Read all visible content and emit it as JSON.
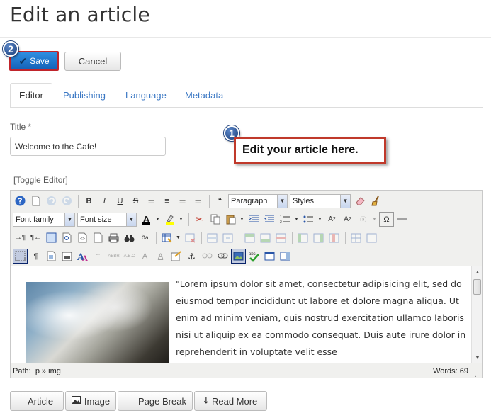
{
  "page": {
    "title": "Edit an article"
  },
  "toolbar": {
    "save_label": "Save",
    "cancel_label": "Cancel"
  },
  "badges": {
    "save_step": "2",
    "editor_step": "1"
  },
  "tabs": [
    {
      "label": "Editor",
      "active": true
    },
    {
      "label": "Publishing"
    },
    {
      "label": "Language"
    },
    {
      "label": "Metadata"
    }
  ],
  "form": {
    "title_label": "Title *",
    "title_value": "Welcome to the Cafe!"
  },
  "callout": {
    "text": "Edit your article here."
  },
  "toggle_editor": "[Toggle Editor]",
  "editor": {
    "format_select": "Paragraph",
    "styles_select": "Styles",
    "font_family_select": "Font family",
    "font_size_select": "Font size",
    "content_text": "\"Lorem ipsum dolor sit amet, consectetur adipisicing elit, sed do eiusmod tempor incididunt ut labore et dolore magna aliqua. Ut enim ad minim veniam, quis nostrud exercitation ullamco laboris nisi ut aliquip ex ea commodo consequat. Duis aute irure dolor in reprehenderit in voluptate velit esse",
    "path_label": "Path:",
    "path_value": "p » img",
    "word_count": "Words: 69"
  },
  "bottom_buttons": {
    "article": "Article",
    "image": "Image",
    "page_break": "Page Break",
    "read_more": "Read More"
  },
  "colors": {
    "accent": "#3b78c4",
    "save_bg": "#1f73cf",
    "highlight_border": "#c0242b"
  }
}
